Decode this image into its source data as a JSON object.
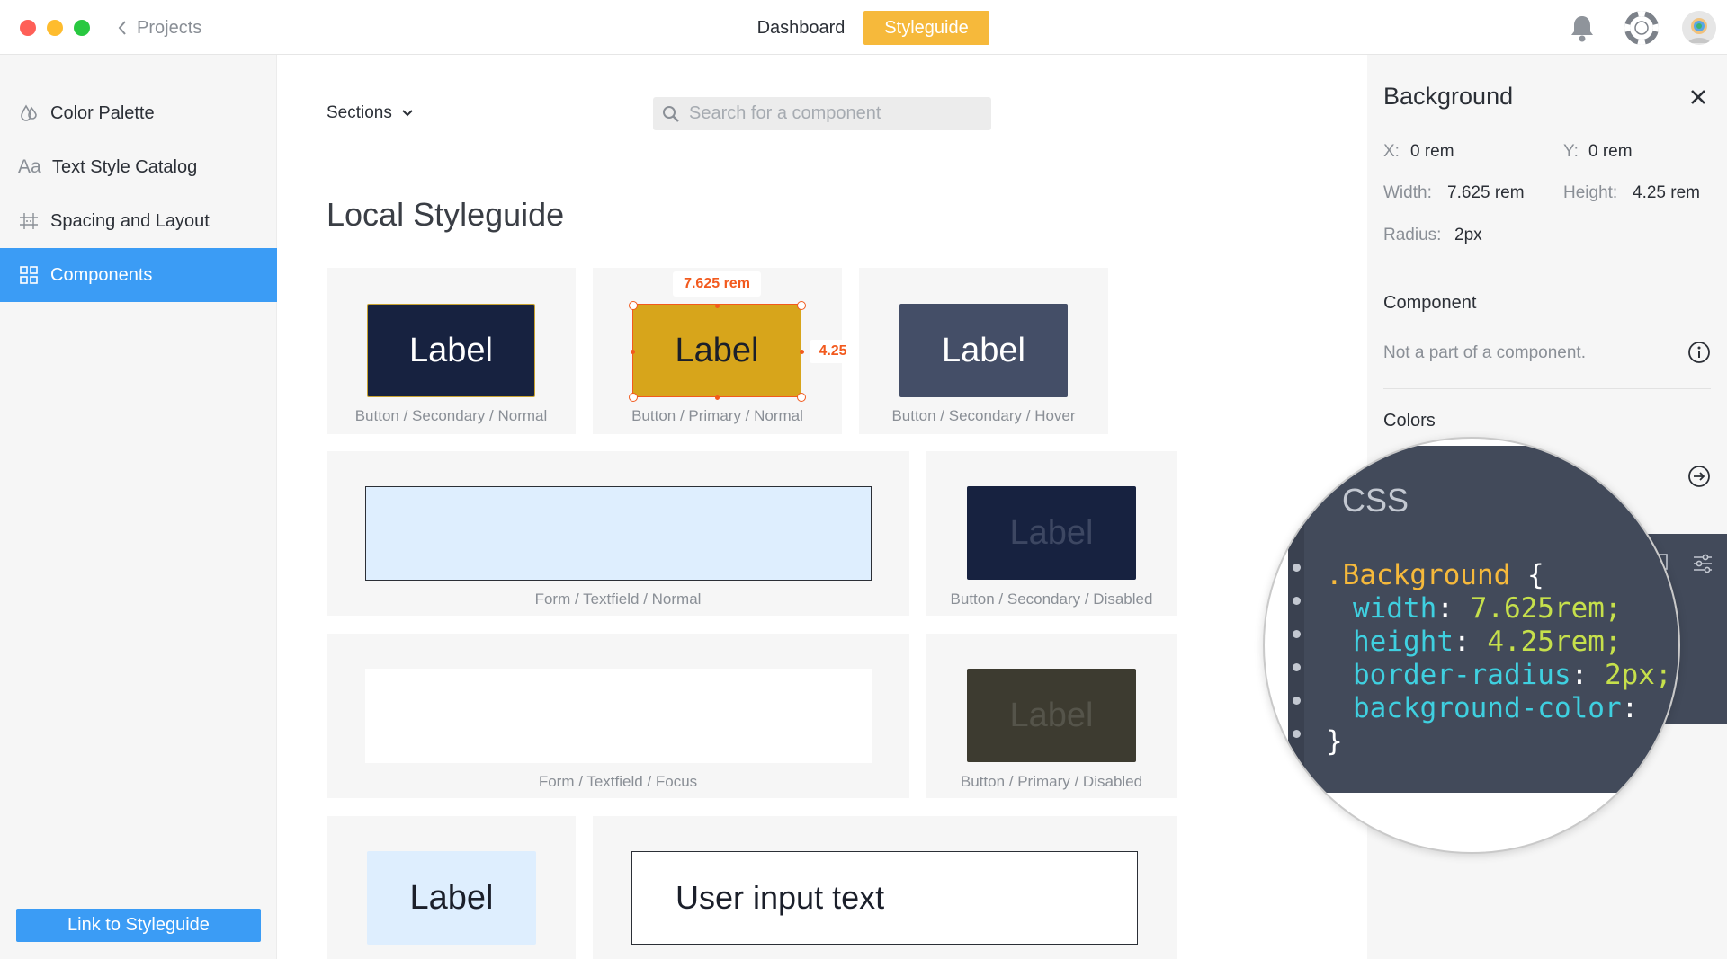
{
  "window": {
    "traffic_lights": {
      "close": "#fe5f57",
      "minimize": "#febc2e",
      "zoom": "#28c840"
    }
  },
  "header": {
    "back_label": "Projects",
    "tabs": [
      {
        "label": "Dashboard",
        "active": false
      },
      {
        "label": "Styleguide",
        "active": true
      }
    ],
    "accent": "#f6b93b"
  },
  "sidebar": {
    "items": [
      {
        "label": "Color Palette",
        "icon": "drops-icon",
        "active": false
      },
      {
        "label": "Text Style Catalog",
        "icon": "aa-icon",
        "active": false
      },
      {
        "label": "Spacing and Layout",
        "icon": "grid-lines-icon",
        "active": false
      },
      {
        "label": "Components",
        "icon": "components-icon",
        "active": true
      }
    ],
    "link_button": "Link to Styleguide",
    "accent": "#3b9cf5"
  },
  "main": {
    "sections_label": "Sections",
    "search_placeholder": "Search for a component",
    "title": "Local Styleguide",
    "cards": [
      {
        "caption": "Button / Secondary / Normal",
        "label": "Label"
      },
      {
        "caption": "Button / Primary / Normal",
        "label": "Label",
        "selected": true
      },
      {
        "caption": "Button / Secondary / Hover",
        "label": "Label"
      },
      {
        "caption": "Form / Textfield / Normal"
      },
      {
        "caption": "Button / Secondary / Disabled",
        "label": "Label"
      },
      {
        "caption": "Form / Textfield / Focus"
      },
      {
        "caption": "Button / Primary / Disabled",
        "label": "Label"
      },
      {
        "label": "Label"
      },
      {
        "input_text": "User input text"
      }
    ],
    "measure_width": "7.625 rem",
    "measure_height": "4.25"
  },
  "panel": {
    "title": "Background",
    "x_label": "X:",
    "x_value": "0 rem",
    "y_label": "Y:",
    "y_value": "0 rem",
    "width_label": "Width:",
    "width_value": "7.625 rem",
    "height_label": "Height:",
    "height_value": "4.25 rem",
    "radius_label": "Radius:",
    "radius_value": "2px",
    "component_heading": "Component",
    "component_text": "Not a part of a component.",
    "colors_heading": "Colors"
  },
  "css": {
    "heading": "CSS",
    "selector": ".Background",
    "open_brace": "{",
    "close_brace": "}",
    "props": [
      {
        "prop": "width",
        "value": "7.625rem;"
      },
      {
        "prop": "height",
        "value": "4.25rem;"
      },
      {
        "prop": "border-radius",
        "value": "2px;"
      },
      {
        "prop": "background-color",
        "value": ""
      }
    ]
  }
}
